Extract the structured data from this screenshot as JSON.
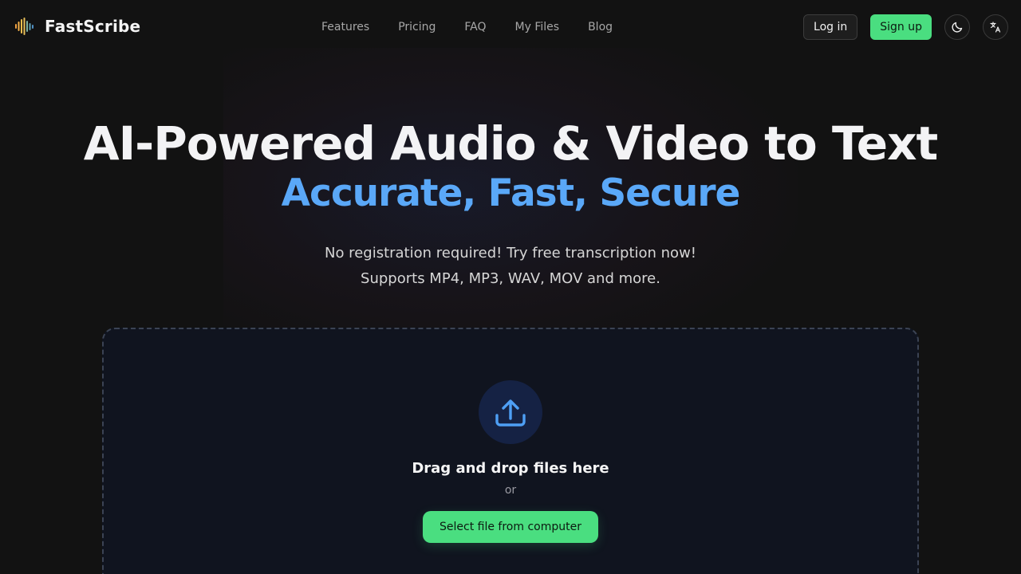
{
  "header": {
    "brand": "FastScribe",
    "nav": [
      "Features",
      "Pricing",
      "FAQ",
      "My Files",
      "Blog"
    ],
    "login": "Log in",
    "signup": "Sign up",
    "icons": [
      "moon-icon",
      "translate-icon"
    ]
  },
  "hero": {
    "title": "AI-Powered Audio & Video to Text",
    "subtitle": "Accurate, Fast, Secure",
    "tagline_1": "No registration required! Try free transcription now!",
    "tagline_2": "Supports MP4, MP3, WAV, MOV and more."
  },
  "upload": {
    "title": "Drag and drop files here",
    "or": "or",
    "button": "Select file from computer"
  },
  "colors": {
    "accent_green": "#4ade80",
    "accent_blue": "#5aa8f8",
    "background": "#121212"
  }
}
